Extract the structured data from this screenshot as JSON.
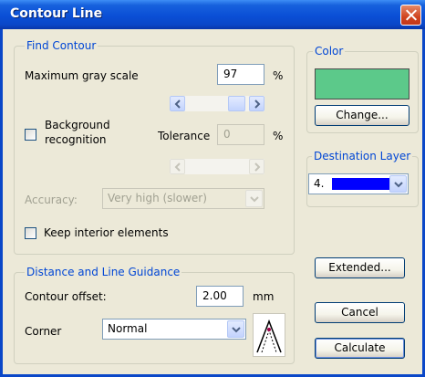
{
  "window": {
    "title": "Contour Line"
  },
  "find_contour": {
    "legend": "Find Contour",
    "max_gray_label": "Maximum gray scale",
    "max_gray_value": "97",
    "max_gray_unit": "%",
    "background_label_line1": "Background",
    "background_label_line2": "recognition",
    "tolerance_label": "Tolerance",
    "tolerance_value": "0",
    "tolerance_unit": "%",
    "accuracy_label": "Accuracy:",
    "accuracy_value": "Very high (slower)",
    "keep_interior_label": "Keep interior elements"
  },
  "color": {
    "legend": "Color",
    "swatch": "#5CC98A",
    "change_label": "Change..."
  },
  "destination": {
    "legend": "Destination Layer",
    "layer_number": "4.",
    "layer_color": "#0000FF"
  },
  "distance": {
    "legend": "Distance and Line Guidance",
    "offset_label": "Contour offset:",
    "offset_value": "2.00",
    "offset_unit": "mm",
    "corner_label": "Corner",
    "corner_value": "Normal"
  },
  "buttons": {
    "extended": "Extended...",
    "cancel": "Cancel",
    "calculate": "Calculate"
  }
}
